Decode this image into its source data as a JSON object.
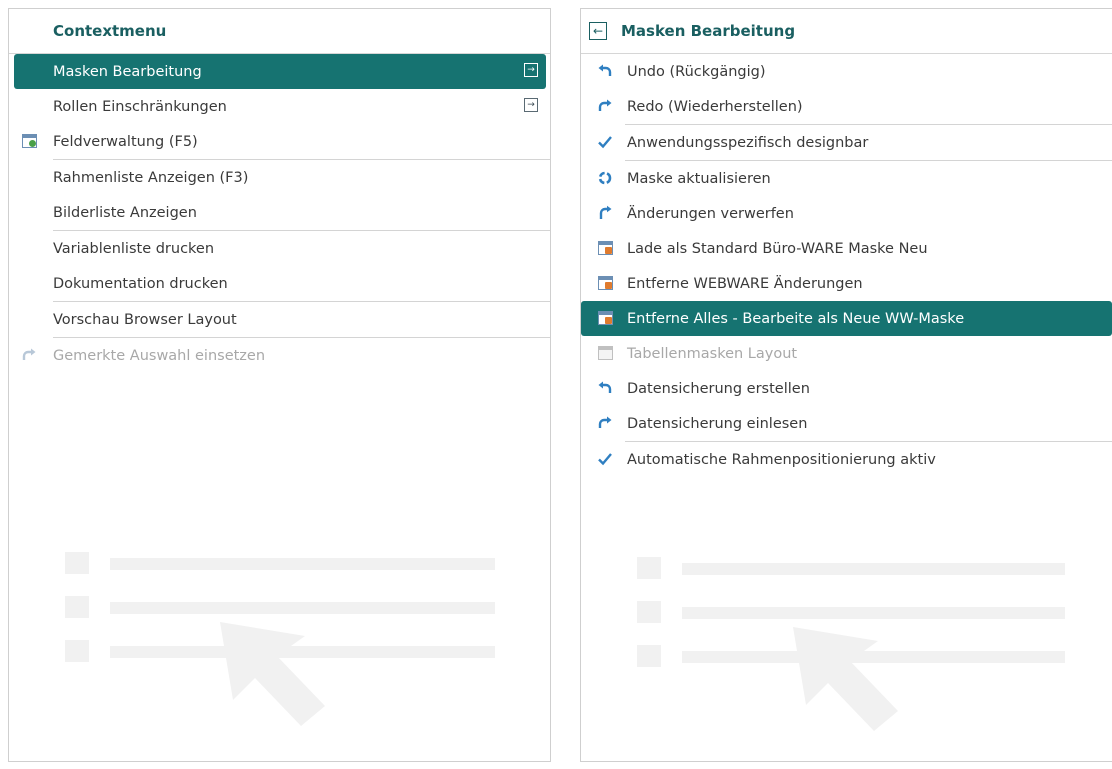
{
  "left_menu": {
    "title": "Contextmenu",
    "items": [
      {
        "label": "Masken Bearbeitung",
        "active": true,
        "submenu": true
      },
      {
        "label": "Rollen Einschränkungen",
        "submenu": true
      },
      {
        "label": "Feldverwaltung (F5)",
        "icon": "table-settings-icon"
      },
      {
        "label": "Rahmenliste Anzeigen (F3)"
      },
      {
        "label": "Bilderliste Anzeigen"
      },
      {
        "label": "Variablenliste drucken"
      },
      {
        "label": "Dokumentation drucken"
      },
      {
        "label": "Vorschau Browser Layout"
      },
      {
        "label": "Gemerkte Auswahl einsetzen",
        "disabled": true,
        "icon": "redo-icon"
      }
    ]
  },
  "right_menu": {
    "title": "Masken Bearbeitung",
    "items": [
      {
        "label": "Undo (Rückgängig)",
        "icon": "undo-icon"
      },
      {
        "label": "Redo (Wiederherstellen)",
        "icon": "redo-icon"
      },
      {
        "label": "Anwendungsspezifisch designbar",
        "icon": "checkmark-icon"
      },
      {
        "label": "Maske aktualisieren",
        "icon": "recycle-icon"
      },
      {
        "label": "Änderungen verwerfen",
        "icon": "revert-icon"
      },
      {
        "label": "Lade als Standard Büro-WARE Maske Neu",
        "icon": "table-icon"
      },
      {
        "label": "Entferne WEBWARE Änderungen",
        "icon": "table-icon"
      },
      {
        "label": "Entferne Alles - Bearbeite als Neue WW-Maske",
        "icon": "table-icon",
        "active": true
      },
      {
        "label": "Tabellenmasken Layout",
        "icon": "table-icon",
        "disabled": true
      },
      {
        "label": "Datensicherung erstellen",
        "icon": "undo-icon"
      },
      {
        "label": "Datensicherung einlesen",
        "icon": "redo-icon"
      },
      {
        "label": "Automatische Rahmenpositionierung aktiv",
        "icon": "checkmark-icon"
      }
    ]
  },
  "colors": {
    "accent": "#167371",
    "header_text": "#1a5f61",
    "icon_blue": "#2f7fc1",
    "disabled_text": "#a8a8a8"
  }
}
